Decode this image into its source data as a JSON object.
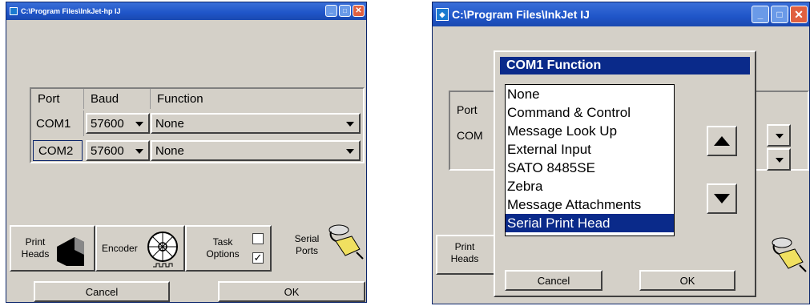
{
  "left_window": {
    "title": "C:\\Program Files\\InkJet-hp   IJ",
    "table": {
      "headers": [
        "Port",
        "Baud",
        "Function"
      ],
      "rows": [
        {
          "port": "COM1",
          "baud": "57600",
          "function": "None"
        },
        {
          "port": "COM2",
          "baud": "57600",
          "function": "None"
        }
      ]
    },
    "tabs": {
      "print_heads": "Print\nHeads",
      "encoder": "Encoder",
      "task_options": "Task\nOptions",
      "serial_ports": "Serial\nPorts"
    },
    "cancel_label": "Cancel",
    "ok_label": "OK"
  },
  "right_window": {
    "title": "C:\\Program Files\\InkJet   IJ",
    "bg_port": "Port",
    "bg_com": "COM",
    "bg_print_heads": "Print\nHeads",
    "popup": {
      "title": "COM1 Function",
      "options": [
        "None",
        "Command & Control",
        "Message Look Up",
        "External Input",
        "SATO 8485SE",
        "Zebra",
        "Message Attachments",
        "Serial Print Head"
      ],
      "selected_index": 7,
      "cancel_label": "Cancel",
      "ok_label": "OK"
    }
  },
  "colors": {
    "titlebar": "#1f55c8",
    "selection": "#0a2a8a",
    "face": "#d4d0c8"
  }
}
